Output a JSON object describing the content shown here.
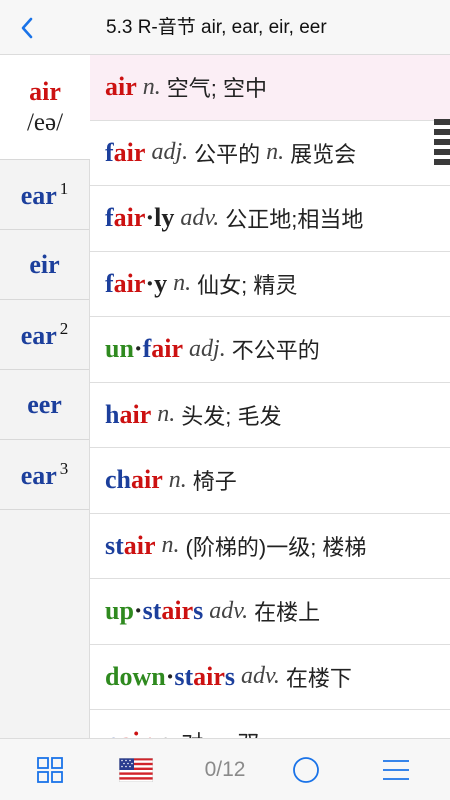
{
  "header": {
    "title": "5.3 R-音节 air, ear, eir, eer",
    "back_icon": "chevron-left-icon"
  },
  "sidebar": {
    "items": [
      {
        "key": "air",
        "sup": "",
        "ipa": "/eə/",
        "active": true
      },
      {
        "key": "ear",
        "sup": "1",
        "ipa": "",
        "active": false
      },
      {
        "key": "eir",
        "sup": "",
        "ipa": "",
        "active": false
      },
      {
        "key": "ear",
        "sup": "2",
        "ipa": "",
        "active": false
      },
      {
        "key": "eer",
        "sup": "",
        "ipa": "",
        "active": false
      },
      {
        "key": "ear",
        "sup": "3",
        "ipa": "",
        "active": false
      }
    ]
  },
  "words": [
    {
      "segments": [
        [
          "air",
          "red"
        ]
      ],
      "pos": "n.",
      "def": "空气; 空中",
      "active": true
    },
    {
      "segments": [
        [
          "f",
          "blue"
        ],
        [
          "air",
          "red"
        ]
      ],
      "pos": "adj.",
      "def": "公平的 ",
      "pos2": "n.",
      "def2": "展览会"
    },
    {
      "segments": [
        [
          "f",
          "blue"
        ],
        [
          "air",
          "red"
        ],
        [
          "·ly",
          "dark"
        ]
      ],
      "pos": "adv.",
      "def": "公正地;相当地"
    },
    {
      "segments": [
        [
          "f",
          "blue"
        ],
        [
          "air",
          "red"
        ],
        [
          "·y",
          "dark"
        ]
      ],
      "pos": "n.",
      "def": "仙女; 精灵"
    },
    {
      "segments": [
        [
          "un",
          "green"
        ],
        [
          "·",
          "dark"
        ],
        [
          "f",
          "blue"
        ],
        [
          "air",
          "red"
        ]
      ],
      "pos": "adj.",
      "def": "不公平的"
    },
    {
      "segments": [
        [
          "h",
          "blue"
        ],
        [
          "air",
          "red"
        ]
      ],
      "pos": "n.",
      "def": "头发; 毛发"
    },
    {
      "segments": [
        [
          "ch",
          "blue"
        ],
        [
          "air",
          "red"
        ]
      ],
      "pos": "n.",
      "def": "椅子"
    },
    {
      "segments": [
        [
          "st",
          "blue"
        ],
        [
          "air",
          "red"
        ]
      ],
      "pos": "n.",
      "def": "(阶梯的)一级; 楼梯"
    },
    {
      "segments": [
        [
          "up",
          "green"
        ],
        [
          "·",
          "dark"
        ],
        [
          "st",
          "blue"
        ],
        [
          "air",
          "red"
        ],
        [
          "s",
          "blue"
        ]
      ],
      "pos": "adv.",
      "def": "在楼上"
    },
    {
      "segments": [
        [
          "down",
          "green"
        ],
        [
          "·",
          "dark"
        ],
        [
          "st",
          "blue"
        ],
        [
          "air",
          "red"
        ],
        [
          "s",
          "blue"
        ]
      ],
      "pos": "adv.",
      "def": "在楼下"
    },
    {
      "segments": [
        [
          "p",
          "blue"
        ],
        [
          "air",
          "red"
        ]
      ],
      "pos": "n.",
      "def": "对; 一双"
    }
  ],
  "footer": {
    "counter": "0/12",
    "icons": [
      "grid-icon",
      "us-flag-icon",
      "circle-icon",
      "menu-icon"
    ]
  },
  "colors": {
    "blue": "#1c3f9c",
    "red": "#cc1111",
    "green": "#2f8a1f",
    "accent": "#1a73e8"
  }
}
